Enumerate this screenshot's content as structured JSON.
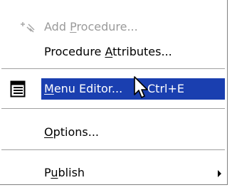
{
  "menu": {
    "items": [
      {
        "label_pre": "Add ",
        "label_u": "P",
        "label_post": "rocedure...",
        "icon": "add-procedure-icon",
        "enabled": false
      },
      {
        "label_pre": "Procedure ",
        "label_u": "A",
        "label_post": "ttributes...",
        "enabled": true
      },
      {
        "label_pre": "",
        "label_u": "M",
        "label_post": "enu Editor...",
        "shortcut": "Ctrl+E",
        "icon": "menu-editor-icon",
        "selected": true
      },
      {
        "label_pre": "",
        "label_u": "O",
        "label_post": "ptions...",
        "enabled": true
      },
      {
        "label_pre": "P",
        "label_u": "u",
        "label_post": "blish",
        "submenu": true,
        "enabled": true
      }
    ]
  },
  "colors": {
    "highlight": "#1a3fb0",
    "disabled_text": "#9a9a9a",
    "menu_bg": "#ffffff"
  },
  "icons": [
    "add-procedure-icon",
    "menu-editor-icon",
    "submenu-arrow-icon",
    "mouse-pointer-icon"
  ]
}
